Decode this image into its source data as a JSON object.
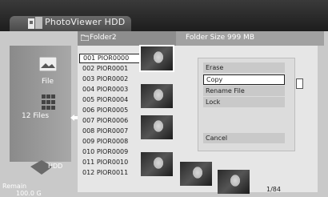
{
  "app": {
    "title": "PhotoViewer  HDD"
  },
  "header": {
    "folder_name": "Folder2",
    "folder_size": "Folder Size 999 MB"
  },
  "left_panel": {
    "file_label": "File",
    "file_count_label": "12 Files",
    "drive_label": "HDD",
    "remain_label": "Remain",
    "remain_value": "100.0 G"
  },
  "files": [
    "001  PIOR0000",
    "002  PIOR0001",
    "003  PIOR0002",
    "004  PIOR0003",
    "005  PIOR0004",
    "006  PIOR0005",
    "007  PIOR0006",
    "008  PIOR0007",
    "009  PIOR0008",
    "010  PIOR0009",
    "011  PIOR0010",
    "012  PIOR0011"
  ],
  "menu": {
    "items": [
      "Erase",
      "Copy",
      "Rename File",
      "Lock"
    ],
    "cancel": "Cancel",
    "selected": "Copy"
  },
  "pager": "1/84",
  "icons": [
    "photo-folder-icon",
    "folder-icon",
    "file-thumbnail-icon",
    "grid-icon",
    "left-arrow-icon",
    "hdd-icon"
  ],
  "colors": {
    "title_bg": "#1d1d1d",
    "panel_bg": "#e6e6e6",
    "selection": "#ffffff"
  }
}
